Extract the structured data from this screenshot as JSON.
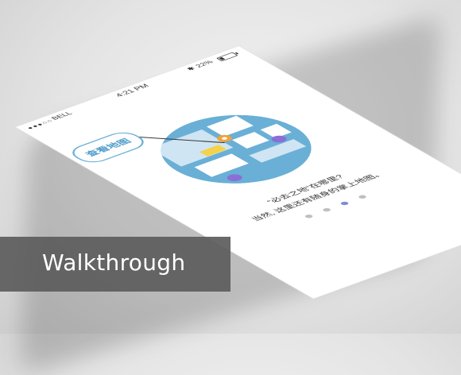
{
  "status_bar": {
    "signal": "●●●○○",
    "carrier": "BELL",
    "time": "4:21 PM",
    "battery_percent": "22%",
    "battery_level": 0.22
  },
  "illustration": {
    "bubble_label": "查看地图"
  },
  "caption": {
    "line1": "“必去之地”在哪里?",
    "line2": "当然, 这里还有随身的掌上地图。"
  },
  "pager": {
    "total": 4,
    "active_index": 2
  },
  "banner": {
    "label": "Walkthrough"
  },
  "colors": {
    "map_blue": "#6aafd6",
    "map_light": "#cfe5f3",
    "marker_orange": "#f0a23b",
    "marker_yellow": "#f6d24a",
    "pin_purple": "#8a6fd6",
    "banner_gray": "#5c5c5c"
  }
}
